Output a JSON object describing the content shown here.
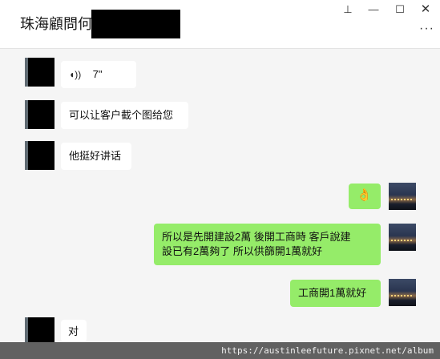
{
  "header": {
    "title": "珠海顧問何",
    "pin_glyph": "⊥",
    "min_glyph": "—",
    "max_glyph": "☐",
    "close_glyph": "✕",
    "more_glyph": "···"
  },
  "messages": [
    {
      "side": "left",
      "type": "voice",
      "duration": "7\"",
      "voice_glyph": "◖))"
    },
    {
      "side": "left",
      "text": "可以让客户截个图给您"
    },
    {
      "side": "left",
      "text": "他挺好讲话"
    },
    {
      "side": "right",
      "type": "emoji",
      "text": "👌"
    },
    {
      "side": "right",
      "text_line1": "所以是先開建設2萬  後開工商時  客戶說建",
      "text_line2": "設已有2萬夠了  所以供篩開1萬就好"
    },
    {
      "side": "right",
      "text": "工商開1萬就好"
    },
    {
      "side": "left",
      "text": "对"
    }
  ],
  "watermark": "https://austinleefuture.pixnet.net/album"
}
